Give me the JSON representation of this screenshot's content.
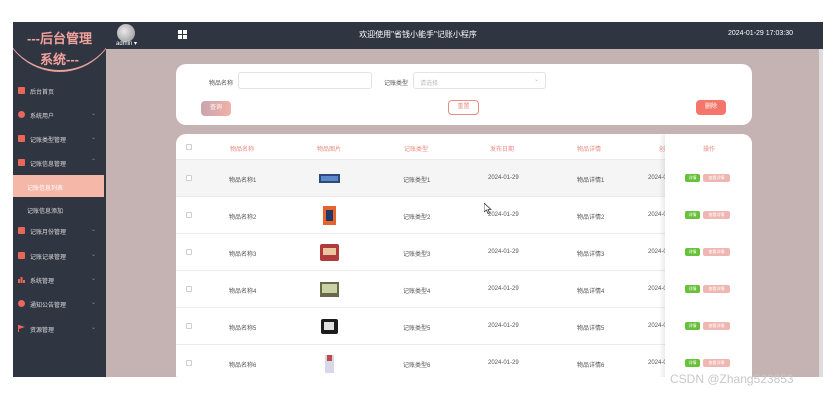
{
  "header": {
    "title": "欢迎使用\"省钱小能手\"记账小程序",
    "datetime": "2024-01-29 17:03:30",
    "user": "admin ▾"
  },
  "sidebar": {
    "brand_line1": "---后台管理",
    "brand_line2": "系统---",
    "items": [
      {
        "label": "后台首页",
        "icon": "monitor-icon"
      },
      {
        "label": "系统用户",
        "icon": "user-icon"
      },
      {
        "label": "记账类型管理",
        "icon": "checkbox-icon"
      },
      {
        "label": "记账信息管理",
        "icon": "checkbox-icon"
      },
      {
        "label": "记账月份管理",
        "icon": "checkbox-icon"
      },
      {
        "label": "记账记录管理",
        "icon": "checkbox-icon"
      },
      {
        "label": "系统管理",
        "icon": "bar-chart-icon"
      },
      {
        "label": "通知公告管理",
        "icon": "info-icon"
      },
      {
        "label": "资源管理",
        "icon": "flag-icon"
      }
    ],
    "subitems": [
      {
        "label": "记账信息列表",
        "active": true
      },
      {
        "label": "记账信息添加",
        "active": false
      }
    ]
  },
  "search": {
    "name_label": "物品名称",
    "name_value": "",
    "type_label": "记账类型",
    "type_placeholder": "请选择",
    "query_button": "查询",
    "reset_button": "重置",
    "delete_button": "删除"
  },
  "table": {
    "columns": [
      "物品名称",
      "物品图片",
      "记账类型",
      "发布日期",
      "物品详情",
      "创",
      "操作"
    ],
    "rows": [
      {
        "name": "物品名称1",
        "type": "记账类型1",
        "date": "2024-01-29",
        "detail": "物品详情1",
        "created": "2024-0"
      },
      {
        "name": "物品名称2",
        "type": "记账类型2",
        "date": "2024-01-29",
        "detail": "物品详情2",
        "created": "2024-0"
      },
      {
        "name": "物品名称3",
        "type": "记账类型3",
        "date": "2024-01-29",
        "detail": "物品详情3",
        "created": "2024-0"
      },
      {
        "name": "物品名称4",
        "type": "记账类型4",
        "date": "2024-01-29",
        "detail": "物品详情4",
        "created": "2024-0"
      },
      {
        "name": "物品名称5",
        "type": "记账类型5",
        "date": "2024-01-29",
        "detail": "物品详情5",
        "created": "2024-0"
      },
      {
        "name": "物品名称6",
        "type": "记账类型6",
        "date": "2024-01-29",
        "detail": "物品详情6",
        "created": "2024-0"
      }
    ],
    "op_detail": "详情",
    "op_view": "查看详情"
  },
  "colors": {
    "accent": "#f28b82",
    "sidebar_bg": "#2f3541",
    "content_bg": "#c5b3b3",
    "success": "#67c23a"
  },
  "watermark": "CSDN @Zhang523853"
}
